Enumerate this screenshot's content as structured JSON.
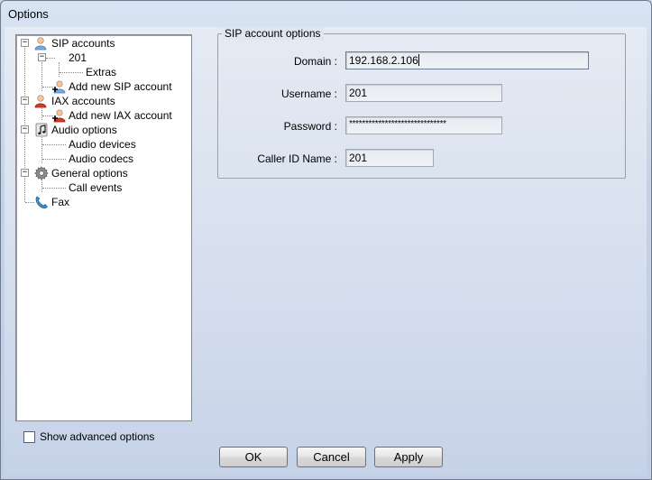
{
  "window": {
    "title": "Options"
  },
  "tree": {
    "items": [
      {
        "label": "SIP accounts",
        "expander": "−",
        "icon": "user-icon"
      },
      {
        "label": "201",
        "expander": "−"
      },
      {
        "label": "Extras"
      },
      {
        "label": "Add new SIP account",
        "icon": "add-user-icon"
      },
      {
        "label": "IAX accounts",
        "expander": "−",
        "icon": "user-red-icon"
      },
      {
        "label": "Add new IAX account",
        "icon": "add-user-red-icon"
      },
      {
        "label": "Audio options",
        "expander": "−",
        "icon": "music-note-icon"
      },
      {
        "label": "Audio devices"
      },
      {
        "label": "Audio codecs"
      },
      {
        "label": "General options",
        "expander": "−",
        "icon": "gear-icon"
      },
      {
        "label": "Call events"
      },
      {
        "label": "Fax",
        "icon": "phone-icon"
      }
    ]
  },
  "sip_account_options": {
    "title": "SIP account options",
    "domain": {
      "label": "Domain :",
      "value": "192.168.2.106"
    },
    "username": {
      "label": "Username :",
      "value": "201"
    },
    "password": {
      "label": "Password :",
      "value": "******************************"
    },
    "caller_id": {
      "label": "Caller ID Name :",
      "value": "201"
    }
  },
  "show_advanced": {
    "label": "Show advanced options",
    "checked": false
  },
  "buttons": {
    "ok": "OK",
    "cancel": "Cancel",
    "apply": "Apply"
  }
}
